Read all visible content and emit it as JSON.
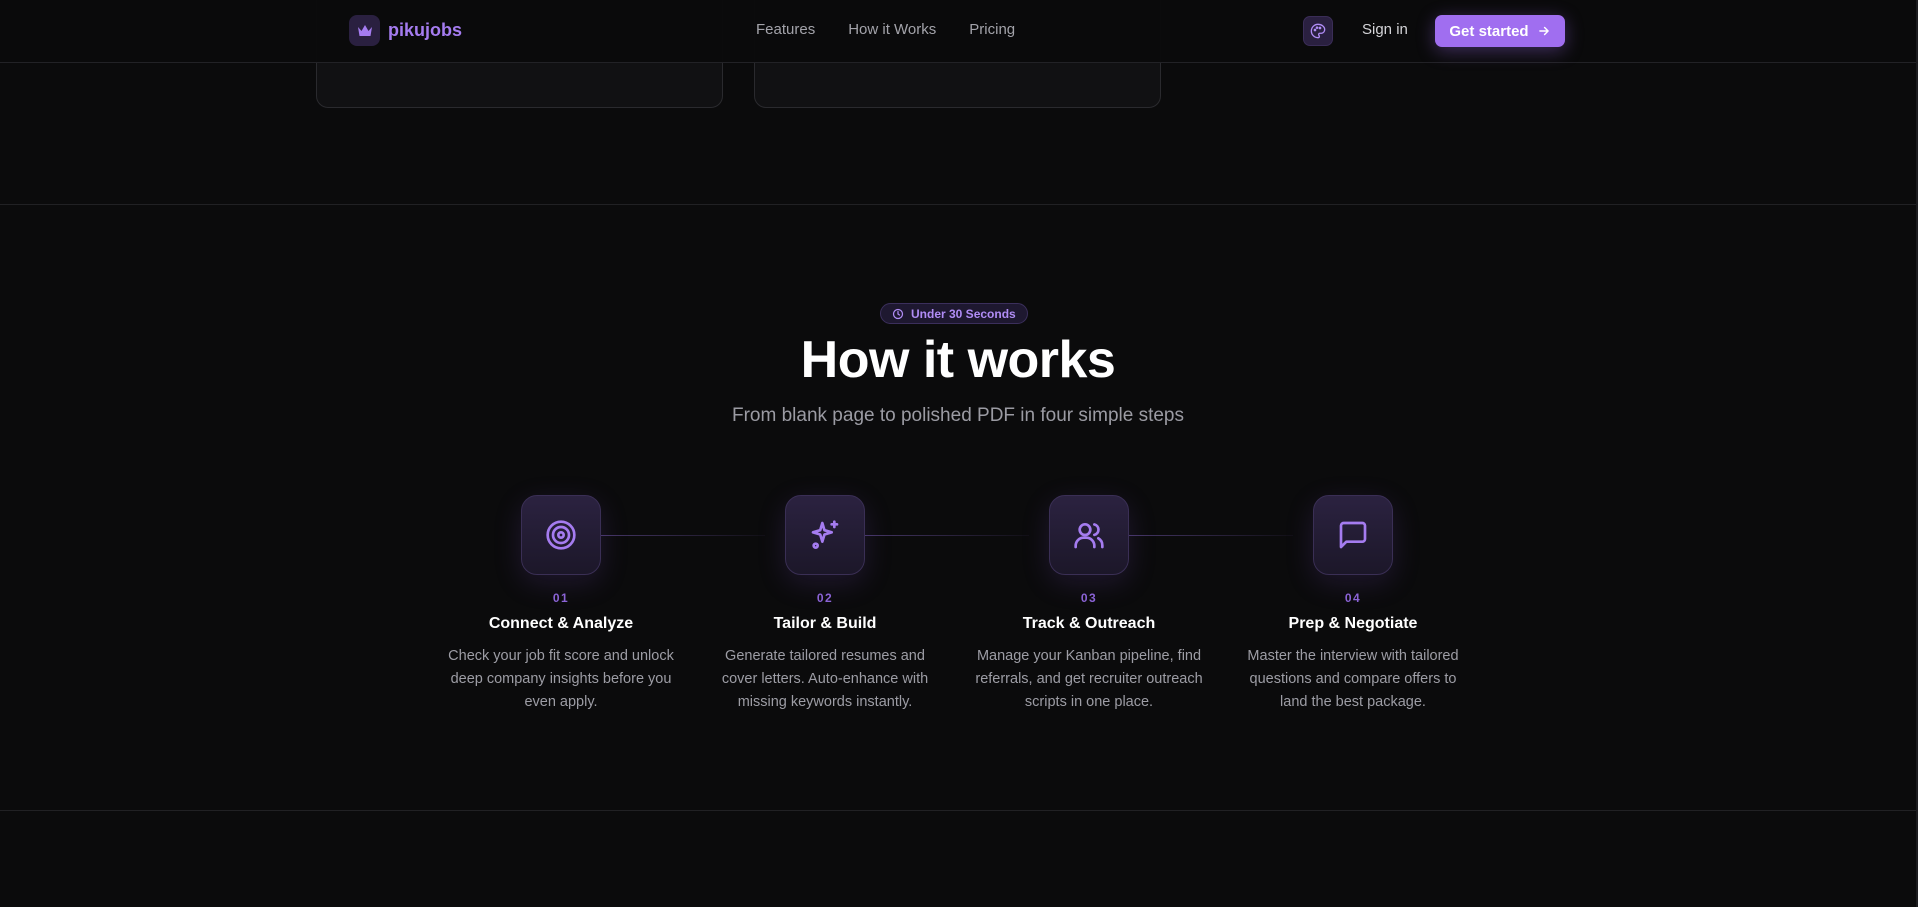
{
  "brand": {
    "name": "pikujobs",
    "logo_icon": "crown-icon",
    "accent": "#a57cf0"
  },
  "nav": {
    "links": [
      "Features",
      "How it Works",
      "Pricing"
    ],
    "theme_icon": "palette-icon",
    "signin_label": "Sign in",
    "cta_label": "Get started"
  },
  "section": {
    "badge": "Under 30 Seconds",
    "badge_icon": "clock-icon",
    "title": "How it works",
    "subtitle": "From blank page to polished PDF in four simple steps"
  },
  "steps": [
    {
      "num": "01",
      "icon": "target-icon",
      "title": "Connect & Analyze",
      "desc": "Check your job fit score and unlock deep company insights before you even apply."
    },
    {
      "num": "02",
      "icon": "sparkles-icon",
      "title": "Tailor & Build",
      "desc": "Generate tailored resumes and cover letters. Auto-enhance with missing keywords instantly."
    },
    {
      "num": "03",
      "icon": "users-icon",
      "title": "Track & Outreach",
      "desc": "Manage your Kanban pipeline, find referrals, and get recruiter outreach scripts in one place."
    },
    {
      "num": "04",
      "icon": "message-square-icon",
      "title": "Prep & Negotiate",
      "desc": "Master the interview with tailored questions and compare offers to land the best package."
    }
  ],
  "colors": {
    "background": "#0b0b0c",
    "accent": "#a06ef0",
    "step_number": "#8b63d6"
  }
}
